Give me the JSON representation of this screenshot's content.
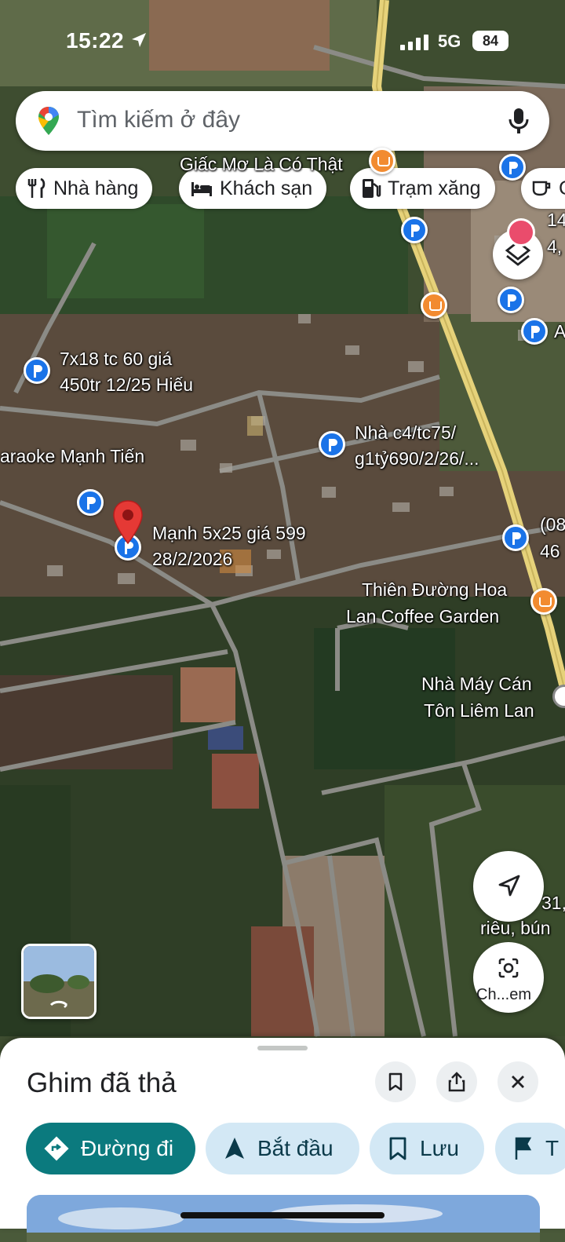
{
  "status_bar": {
    "time": "15:22",
    "network": "5G",
    "battery": "84"
  },
  "search": {
    "placeholder": "Tìm kiếm ở đây"
  },
  "chips": [
    {
      "label": "Nhà hàng",
      "icon": "fork-knife-icon"
    },
    {
      "label": "Khách sạn",
      "icon": "bed-icon"
    },
    {
      "label": "Trạm xăng",
      "icon": "gas-station-icon"
    },
    {
      "label": "C",
      "icon": "coffee-icon"
    }
  ],
  "map_labels": {
    "giac_mo": "Giấc Mơ Là Có Thật",
    "listing_7x18_line1": "7x18 tc 60 giá",
    "listing_7x18_line2": "450tr 12/25 Hiếu",
    "karaoke": "araoke Mạnh Tiến",
    "listing_nha_c4_line1": "Nhà c4/tc75/",
    "listing_nha_c4_line2": "g1tỷ690/2/26/...",
    "listing_manh_line1": "Mạnh 5x25 giá 599",
    "listing_manh_line2": "28/2/2026",
    "thien_duong_line1": "Thiên Đường Hoa",
    "thien_duong_line2": "Lan Coffee Garden",
    "nha_may_line1": "Nhà Máy Cán",
    "nha_may_line2": "Tôn Liêm Lan",
    "edge_08": "(08",
    "edge_46": "46",
    "edge_14": "14",
    "edge_4": "4,",
    "edge_A": "A",
    "edge_31": "31,",
    "edge_rieu": "riêu, bún"
  },
  "buttons": {
    "chip_camera_label": "Ch...em"
  },
  "sheet": {
    "title": "Ghim đã thả",
    "actions": [
      {
        "label": "Đường đi",
        "icon": "directions-icon"
      },
      {
        "label": "Bắt đầu",
        "icon": "navigation-arrow-icon"
      },
      {
        "label": "Lưu",
        "icon": "bookmark-icon"
      },
      {
        "label": "T",
        "icon": "flag-icon"
      }
    ]
  },
  "colors": {
    "accent_teal": "#0b7a7e",
    "chip_blue_bg": "#d3e8f5",
    "pin_red": "#e53935",
    "marker_blue": "#1a73e8",
    "marker_orange": "#f28b30"
  }
}
